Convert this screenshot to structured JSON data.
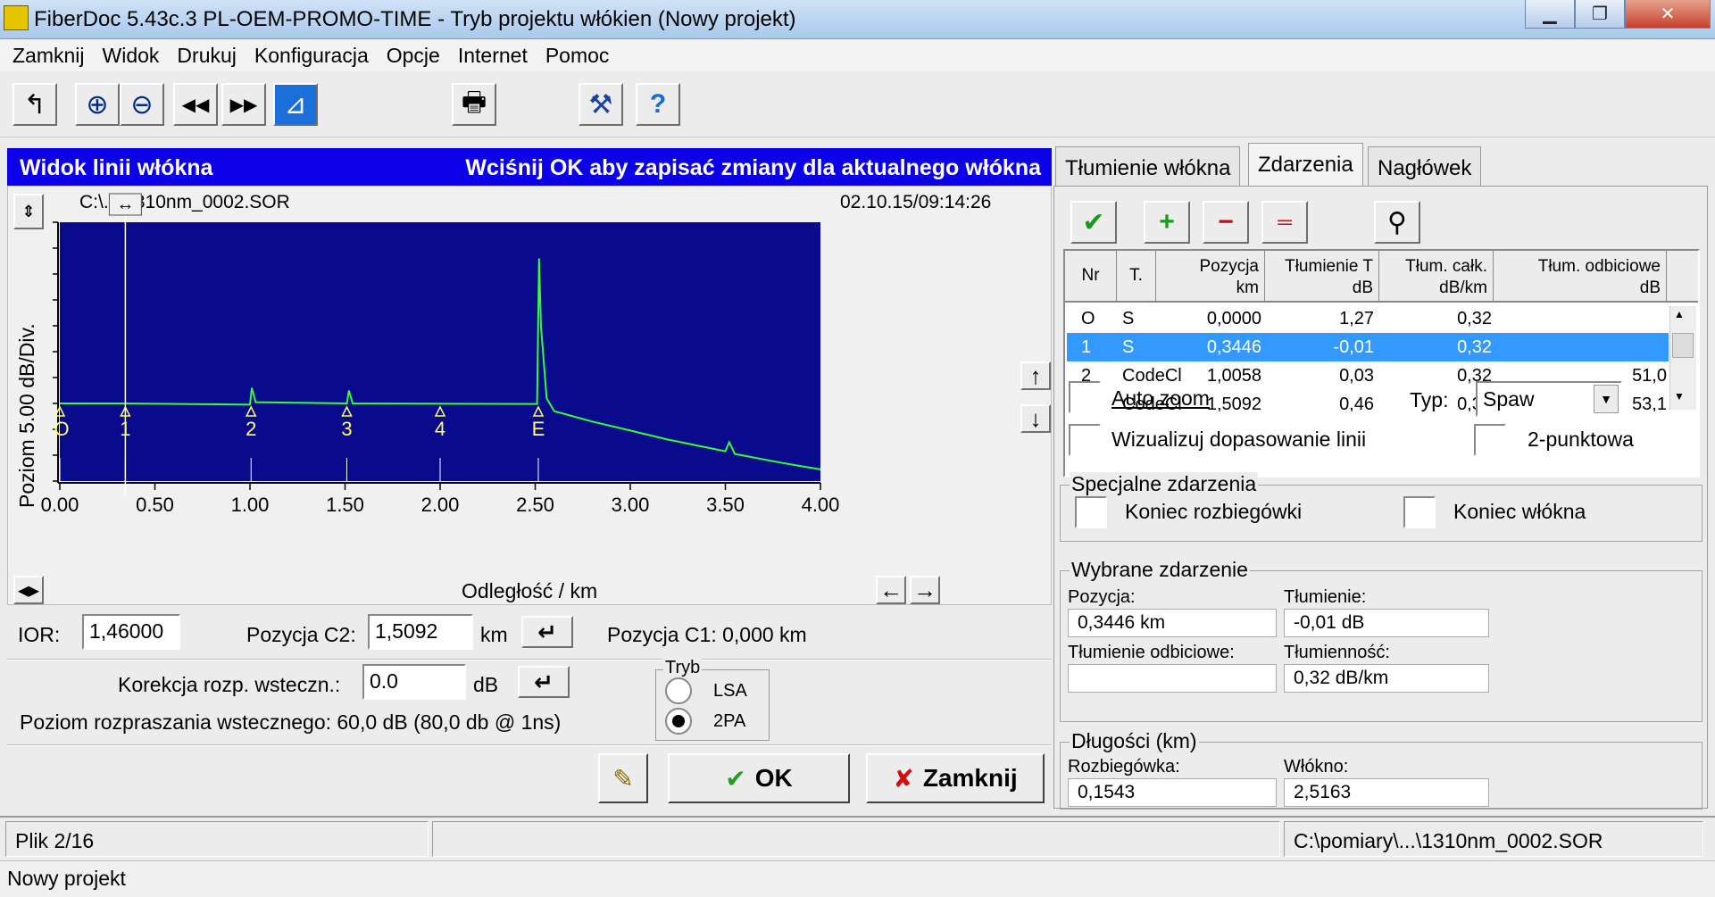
{
  "window": {
    "title": "FiberDoc 5.43c.3 PL-OEM-PROMO-TIME - Tryb projektu włókien (Nowy projekt)",
    "buttons": {
      "minimize": "▁",
      "maximize": "❐",
      "close": "✕"
    }
  },
  "menu": [
    "Zamknij",
    "Widok",
    "Drukuj",
    "Konfiguracja",
    "Opcje",
    "Internet",
    "Pomoc"
  ],
  "toolbar": {
    "icons": [
      "back-arrow-icon",
      "zoom-in-icon",
      "zoom-out-icon",
      "rewind-icon",
      "fast-forward-icon",
      "trace-view-icon",
      "printer-icon",
      "tools-icon",
      "help-icon"
    ],
    "glyphs": {
      "back": "↰",
      "zoomin": "⊕",
      "zoomout": "⊖",
      "prev": "◀◀",
      "next": "▶▶",
      "trace": "⊿",
      "print": "🖶",
      "tools": "⚒",
      "help": "?"
    }
  },
  "trace_panel": {
    "header_left": "Widok linii włókna",
    "header_right": "Wciśnij OK aby zapisać zmiany dla aktualnego włókna",
    "file_name": "C:\\...\\1310nm_0002.SOR",
    "datetime": "02.10.15/09:14:26",
    "ylabel": "Poziom   5.00 dB/Div.",
    "xlabel": "Odległość / km"
  },
  "chart_data": {
    "type": "line",
    "xlabel": "Odległość / km",
    "ylabel": "Poziom   5.00 dB/Div.",
    "x_ticks": [
      "0.00",
      "0.50",
      "1.00",
      "1.50",
      "2.00",
      "2.50",
      "3.00",
      "3.50",
      "4.00"
    ],
    "xlim": [
      0,
      4.0
    ],
    "y_div_db": 5.0,
    "y_divisions": 10,
    "grid": false,
    "background": "#0a0a8c",
    "trace_color": "#33ff33",
    "baseline_level_div": 3.0,
    "trace": [
      {
        "x": 0.0,
        "y": 3.0
      },
      {
        "x": 0.33,
        "y": 3.0
      },
      {
        "x": 1.0,
        "y": 2.95
      },
      {
        "x": 1.01,
        "y": 3.6
      },
      {
        "x": 1.03,
        "y": 3.05
      },
      {
        "x": 1.51,
        "y": 3.0
      },
      {
        "x": 1.52,
        "y": 3.5
      },
      {
        "x": 1.54,
        "y": 3.0
      },
      {
        "x": 2.51,
        "y": 2.98
      },
      {
        "x": 2.52,
        "y": 8.6
      },
      {
        "x": 2.53,
        "y": 6.0
      },
      {
        "x": 2.56,
        "y": 3.2
      },
      {
        "x": 2.6,
        "y": 2.7
      },
      {
        "x": 2.8,
        "y": 2.3
      },
      {
        "x": 3.0,
        "y": 1.95
      },
      {
        "x": 3.2,
        "y": 1.6
      },
      {
        "x": 3.5,
        "y": 1.15
      },
      {
        "x": 3.52,
        "y": 1.5
      },
      {
        "x": 3.55,
        "y": 1.05
      },
      {
        "x": 3.8,
        "y": 0.7
      },
      {
        "x": 4.0,
        "y": 0.45
      }
    ],
    "events": [
      {
        "label": "O",
        "x": 0.0
      },
      {
        "label": "1",
        "x": 0.3446
      },
      {
        "label": "2",
        "x": 1.0058
      },
      {
        "label": "3",
        "x": 1.5092
      },
      {
        "label": "4",
        "x": 2.0
      },
      {
        "label": "E",
        "x": 2.5163
      }
    ],
    "cursor_c1_km": 0.3446
  },
  "controls": {
    "ior_label": "IOR:",
    "ior_value": "1,46000",
    "c2_label": "Pozycja C2:",
    "c2_value": "1,5092",
    "c2_unit": "km",
    "c1_text": "Pozycja C1:  0,000 km",
    "backscatter_label": "Korekcja rozp. wsteczn.:",
    "backscatter_value": "0.0",
    "backscatter_unit": "dB",
    "backscatter_level": "Poziom rozpraszania wstecznego:  60,0 dB (80,0 db @ 1ns)",
    "mode_label": "Tryb",
    "mode_lsa": "LSA",
    "mode_2pa": "2PA",
    "ok_label": "OK",
    "close_label": "Zamknij",
    "enter_glyph": "↵"
  },
  "tabs": [
    "Tłumienie włókna",
    "Zdarzenia",
    "Nagłówek"
  ],
  "events_table": {
    "headers": [
      {
        "top": "Nr",
        "bottom": ""
      },
      {
        "top": "T.",
        "bottom": ""
      },
      {
        "top": "Pozycja",
        "bottom": "km"
      },
      {
        "top": "Tłumienie T",
        "bottom": "dB"
      },
      {
        "top": "Tłum. całk.",
        "bottom": "dB/km"
      },
      {
        "top": "Tłum. odbiciowe",
        "bottom": "dB"
      }
    ],
    "rows": [
      {
        "nr": "O",
        "t": "S",
        "pos": "0,0000",
        "att": "1,27",
        "tot": "0,32",
        "refl": ""
      },
      {
        "nr": "1",
        "t": "S",
        "pos": "0,3446",
        "att": "-0,01",
        "tot": "0,32",
        "refl": ""
      },
      {
        "nr": "2",
        "t": "CodeCl",
        "pos": "1,0058",
        "att": "0,03",
        "tot": "0,32",
        "refl": "51,0"
      },
      {
        "nr": "3",
        "t": "CodeCl",
        "pos": "1,5092",
        "att": "0,46",
        "tot": "0,32",
        "refl": "53,1"
      }
    ],
    "selected_row": 1
  },
  "options": {
    "auto_zoom": "Auto zoom",
    "typ_label": "Typ:",
    "typ_value": "Spaw",
    "visualize": "Wizualizuj dopasowanie linii",
    "two_point": "2-punktowa",
    "special_events": "Specjalne zdarzenia",
    "launch_end": "Koniec rozbiegówki",
    "fiber_end": "Koniec włókna"
  },
  "selected_event": {
    "title": "Wybrane zdarzenie",
    "position_label": "Pozycja:",
    "position_value": "0,3446 km",
    "att_label": "Tłumienie:",
    "att_value": "-0,01 dB",
    "refl_label": "Tłumienie odbiciowe:",
    "refl_value": "",
    "rate_label": "Tłumienność:",
    "rate_value": "0,32 dB/km"
  },
  "lengths": {
    "title": "Długości (km)",
    "launch_label": "Rozbiegówka:",
    "launch_value": "0,1543",
    "fiber_label": "Włókno:",
    "fiber_value": "2,5163"
  },
  "status": {
    "file": "Plik 2/16",
    "path": "C:\\pomiary\\...\\1310nm_0002.SOR",
    "project": "Nowy projekt"
  }
}
